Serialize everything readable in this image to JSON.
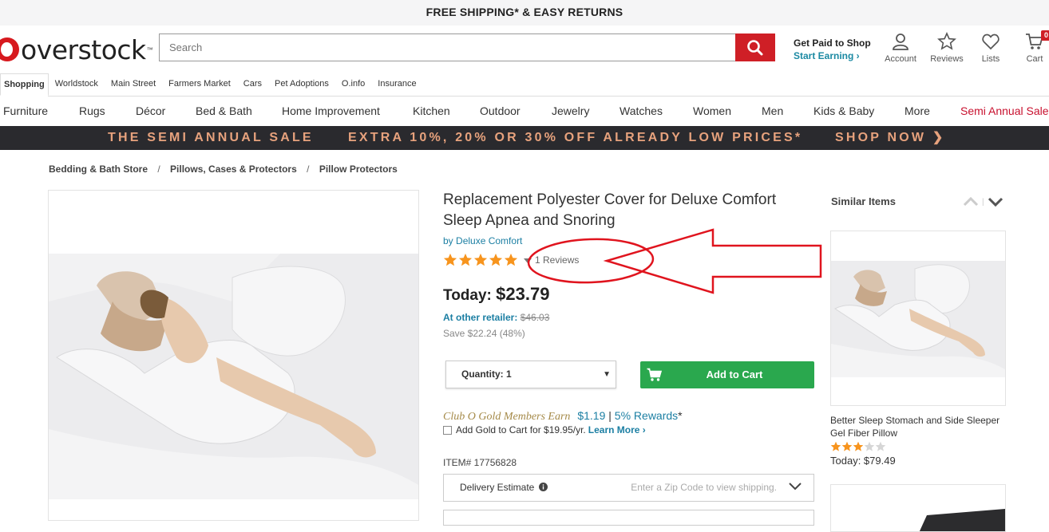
{
  "promo": {
    "text": "FREE SHIPPING* & EASY RETURNS"
  },
  "header": {
    "logo_text": "overstock",
    "logo_tm": "™",
    "search_placeholder": "Search",
    "paid_line1": "Get Paid to Shop",
    "paid_line2": "Start Earning ›",
    "icons": [
      {
        "label": "Account",
        "icon": "account-icon"
      },
      {
        "label": "Reviews",
        "icon": "star-outline-icon"
      },
      {
        "label": "Lists",
        "icon": "heart-icon"
      },
      {
        "label": "Cart",
        "icon": "cart-icon"
      }
    ],
    "cart_count": "0"
  },
  "subnav": [
    "Shopping",
    "Worldstock",
    "Main Street",
    "Farmers Market",
    "Cars",
    "Pet Adoptions",
    "O.info",
    "Insurance"
  ],
  "categories": [
    "Furniture",
    "Rugs",
    "Décor",
    "Bed & Bath",
    "Home Improvement",
    "Kitchen",
    "Outdoor",
    "Jewelry",
    "Watches",
    "Women",
    "Men",
    "Kids & Baby",
    "More",
    "Semi Annual Sale"
  ],
  "banner": {
    "left": "THE SEMI ANNUAL SALE",
    "middle": "EXTRA 10%, 20% OR 30% OFF ALREADY LOW PRICES*",
    "right": "SHOP NOW ❯"
  },
  "breadcrumbs": [
    "Bedding & Bath Store",
    "Pillows, Cases & Protectors",
    "Pillow Protectors"
  ],
  "product": {
    "title": "Replacement Polyester Cover for Deluxe Comfort Sleep Apnea and Snoring",
    "brand_prefix": "by",
    "brand": "Deluxe Comfort",
    "rating": 5,
    "reviews": "1 Reviews",
    "today_label": "Today:",
    "price": "$23.79",
    "retail_label": "At other retailer:",
    "retail_price": "$46.03",
    "save": "Save $22.24 (48%)",
    "quantity": "Quantity: 1",
    "add_to_cart": "Add to Cart",
    "club_text": "Club O Gold Members Earn",
    "club_value": "$1.19",
    "club_sep": "|",
    "club_rewards": "5% Rewards",
    "club_asterisk": "*",
    "gold_add": "Add Gold to Cart for $19.95/yr.",
    "learn_more": "Learn More ›",
    "item_no": "ITEM# 17756828",
    "delivery_label": "Delivery Estimate",
    "delivery_hint": "Enter a Zip Code to view shipping."
  },
  "similar": {
    "title": "Similar Items",
    "items": [
      {
        "name": "Better Sleep Stomach and Side Sleeper Gel Fiber Pillow",
        "rating": 3,
        "price": "Today: $79.49"
      }
    ]
  },
  "colors": {
    "brand_red": "#cf1f26",
    "link_blue": "#1c7fa3",
    "cart_green": "#2aa84e",
    "star_orange": "#f7941d",
    "banner_bg": "#2a2a2e",
    "banner_text": "#e7a27d",
    "annotation_red": "#e0141e"
  }
}
